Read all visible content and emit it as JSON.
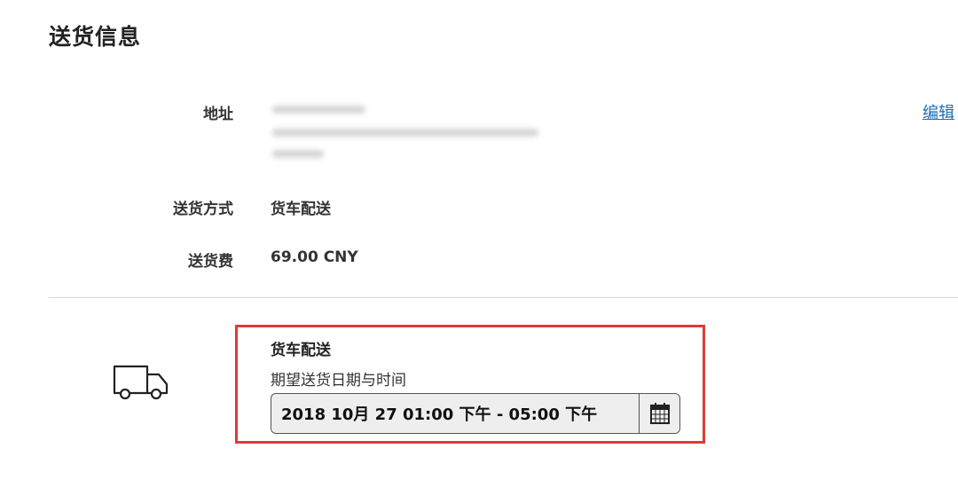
{
  "page": {
    "title": "送货信息"
  },
  "address": {
    "label": "地址",
    "edit_label": "编辑"
  },
  "delivery_method": {
    "label": "送货方式",
    "value": "货车配送"
  },
  "delivery_fee": {
    "label": "送货费",
    "value": "69.00 CNY"
  },
  "schedule": {
    "title": "货车配送",
    "date_label": "期望送货日期与时间",
    "date_value": "2018 10月 27 01:00 下午 - 05:00 下午",
    "truck_icon": "truck-icon",
    "calendar_icon": "calendar-icon"
  },
  "colors": {
    "highlight_border": "#e03a3a",
    "link": "#1f6fb4"
  }
}
